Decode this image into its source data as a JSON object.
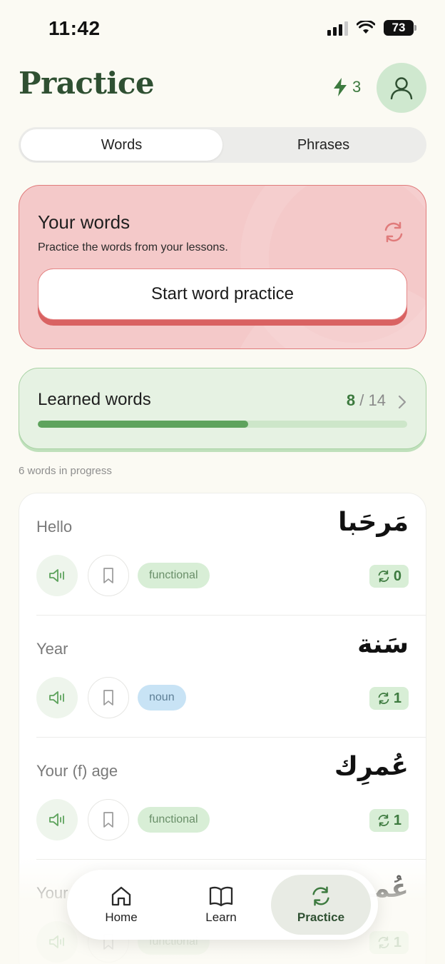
{
  "status_bar": {
    "time": "11:42",
    "battery": "73"
  },
  "header": {
    "title": "Practice",
    "streak_count": "3"
  },
  "tabs": [
    {
      "label": "Words",
      "active": true
    },
    {
      "label": "Phrases",
      "active": false
    }
  ],
  "your_words": {
    "title": "Your words",
    "subtitle": "Practice the words from your lessons.",
    "start_label": "Start word practice"
  },
  "learned": {
    "title": "Learned words",
    "learned": "8",
    "separator": "/",
    "total": "14",
    "progress_fraction": 0.57
  },
  "in_progress_text": "6 words in progress",
  "words": [
    {
      "english": "Hello",
      "arabic": "مَرحَبا",
      "tag": "functional",
      "tag_type": "functional",
      "reviews": "0"
    },
    {
      "english": "Year",
      "arabic": "سَنة",
      "tag": "noun",
      "tag_type": "noun",
      "reviews": "1"
    },
    {
      "english": "Your (f) age",
      "arabic": "عُمرِك",
      "tag": "functional",
      "tag_type": "functional",
      "reviews": "1"
    },
    {
      "english": "Your",
      "arabic": "عُمـ",
      "tag": "functional",
      "tag_type": "functional",
      "reviews": "1"
    }
  ],
  "nav": [
    {
      "label": "Home",
      "icon": "home-icon",
      "active": false
    },
    {
      "label": "Learn",
      "icon": "book-icon",
      "active": false
    },
    {
      "label": "Practice",
      "icon": "refresh-icon",
      "active": true
    }
  ],
  "colors": {
    "brand_green": "#2f5032",
    "accent_green": "#5ea35d",
    "card_red": "#f4c9c9",
    "card_red_border": "#e07b7b"
  }
}
